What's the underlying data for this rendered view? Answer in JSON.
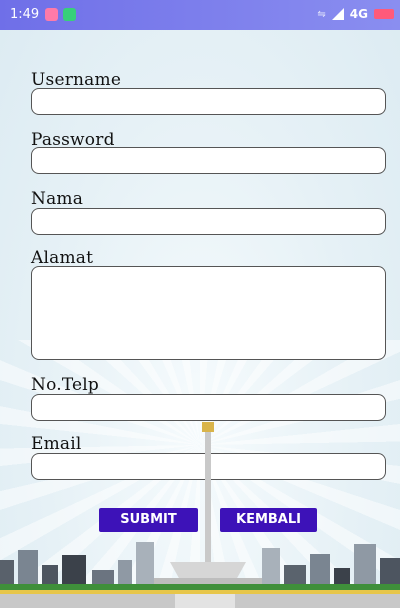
{
  "status_bar": {
    "time": "1:49",
    "network": "4G",
    "icons": [
      "notification-icon",
      "whatsapp-icon",
      "signal-icon",
      "battery-icon"
    ]
  },
  "form": {
    "username_label": "Username",
    "password_label": "Password",
    "nama_label": "Nama",
    "alamat_label": "Alamat",
    "telp_label": "No.Telp",
    "email_label": "Email",
    "username_value": "",
    "password_value": "",
    "nama_value": "",
    "alamat_value": "",
    "telp_value": "",
    "email_value": ""
  },
  "buttons": {
    "submit_label": "SUBMIT",
    "back_label": "KEMBALI"
  },
  "colors": {
    "status_bar": "#7a7cec",
    "button_bg": "#3d12b8",
    "button_text": "#ffffff"
  }
}
